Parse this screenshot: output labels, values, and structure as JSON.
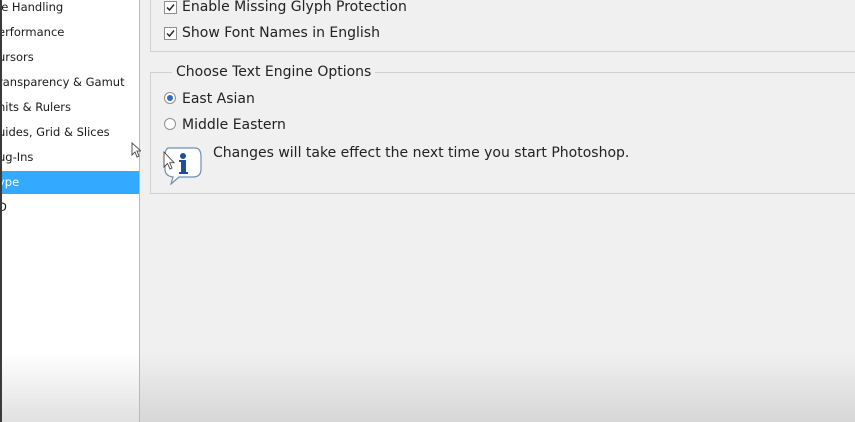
{
  "sidebar": {
    "items": [
      {
        "label": "le Handling",
        "selected": false
      },
      {
        "label": "erformance",
        "selected": false
      },
      {
        "label": "ursors",
        "selected": false
      },
      {
        "label": "ransparency & Gamut",
        "selected": false
      },
      {
        "label": "nits & Rulers",
        "selected": false
      },
      {
        "label": "uides, Grid & Slices",
        "selected": false
      },
      {
        "label": "ug-Ins",
        "selected": false
      },
      {
        "label": "ype",
        "selected": true
      },
      {
        "label": "D",
        "selected": false
      }
    ],
    "selected_color": "#33aaff"
  },
  "font_options": {
    "missing_glyph": {
      "label": "Enable Missing Glyph Protection",
      "checked": true
    },
    "font_names_english": {
      "label": "Show Font Names in English",
      "checked": true
    }
  },
  "text_engine": {
    "legend": "Choose Text Engine Options",
    "options": [
      {
        "label": "East Asian",
        "selected": true
      },
      {
        "label": "Middle Eastern",
        "selected": false
      }
    ],
    "info_icon": "info-icon",
    "info_text": "Changes will take effect the next time you start Photoshop."
  }
}
